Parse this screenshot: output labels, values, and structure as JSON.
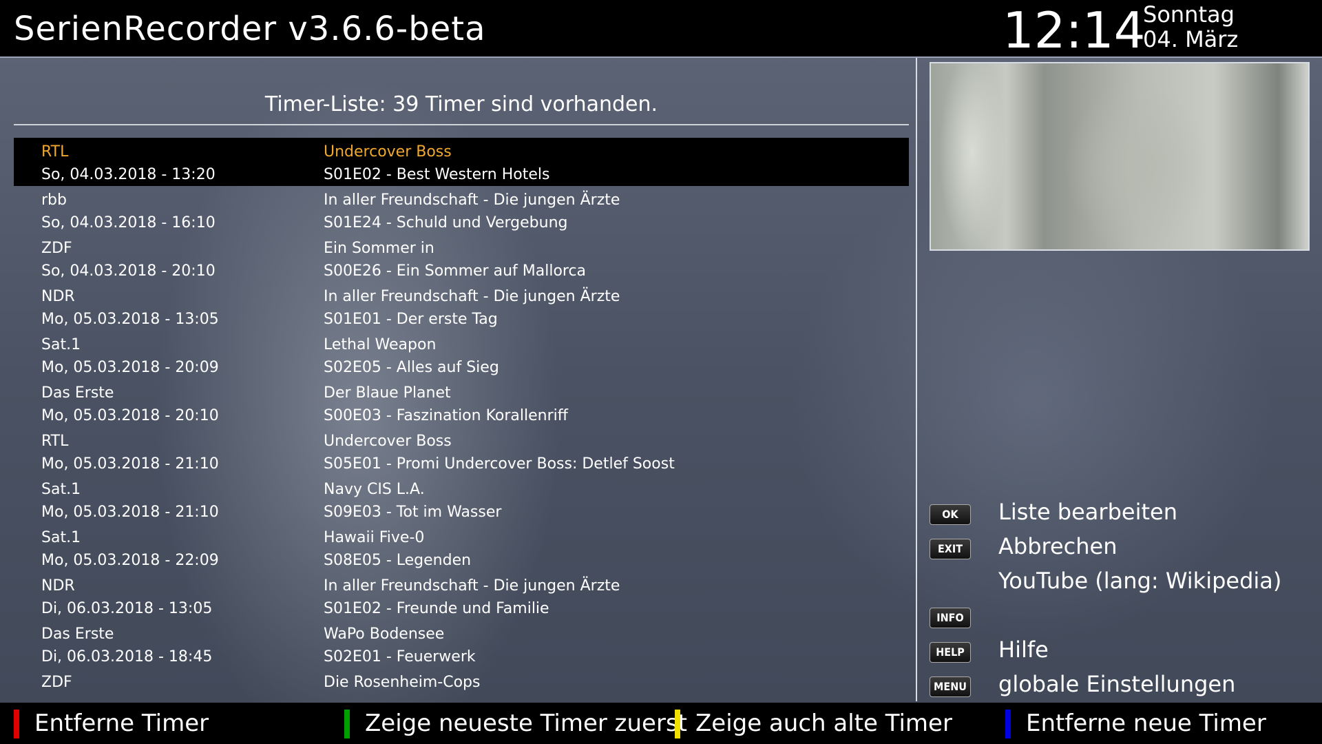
{
  "header": {
    "title": "SerienRecorder v3.6.6-beta",
    "time": "12:14",
    "day": "Sonntag",
    "date": "04. März"
  },
  "list": {
    "heading": "Timer-Liste: 39 Timer sind vorhanden.",
    "rows": [
      {
        "channel": "RTL",
        "datetime": "So, 04.03.2018 - 13:20",
        "series": "Undercover Boss",
        "episode": "S01E02 - Best Western Hotels",
        "selected": true
      },
      {
        "channel": "rbb",
        "datetime": "So, 04.03.2018 - 16:10",
        "series": "In aller Freundschaft - Die jungen Ärzte",
        "episode": "S01E24 - Schuld und Vergebung"
      },
      {
        "channel": "ZDF",
        "datetime": "So, 04.03.2018 - 20:10",
        "series": "Ein Sommer in",
        "episode": "S00E26 - Ein Sommer auf Mallorca"
      },
      {
        "channel": "NDR",
        "datetime": "Mo, 05.03.2018 - 13:05",
        "series": "In aller Freundschaft - Die jungen Ärzte",
        "episode": "S01E01 - Der erste Tag"
      },
      {
        "channel": "Sat.1",
        "datetime": "Mo, 05.03.2018 - 20:09",
        "series": "Lethal Weapon",
        "episode": "S02E05 - Alles auf Sieg"
      },
      {
        "channel": "Das Erste",
        "datetime": "Mo, 05.03.2018 - 20:10",
        "series": "Der Blaue Planet",
        "episode": "S00E03 - Faszination Korallenriff"
      },
      {
        "channel": "RTL",
        "datetime": "Mo, 05.03.2018 - 21:10",
        "series": "Undercover Boss",
        "episode": "S05E01 - Promi Undercover Boss: Detlef Soost"
      },
      {
        "channel": "Sat.1",
        "datetime": "Mo, 05.03.2018 - 21:10",
        "series": "Navy CIS L.A.",
        "episode": "S09E03 - Tot im Wasser"
      },
      {
        "channel": "Sat.1",
        "datetime": "Mo, 05.03.2018 - 22:09",
        "series": "Hawaii Five-0",
        "episode": "S08E05 - Legenden"
      },
      {
        "channel": "NDR",
        "datetime": "Di, 06.03.2018 - 13:05",
        "series": "In aller Freundschaft - Die jungen Ärzte",
        "episode": "S01E02 - Freunde und Familie"
      },
      {
        "channel": "Das Erste",
        "datetime": "Di, 06.03.2018 - 18:45",
        "series": "WaPo Bodensee",
        "episode": "S02E01 - Feuerwerk"
      },
      {
        "channel": "ZDF",
        "datetime": "",
        "series": "Die Rosenheim-Cops",
        "episode": ""
      }
    ]
  },
  "keys": [
    {
      "key": "OK",
      "label": "Liste bearbeiten"
    },
    {
      "key": "EXIT",
      "label": "Abbrechen"
    },
    {
      "key": "",
      "label": "YouTube (lang: Wikipedia)"
    },
    {
      "key": "INFO",
      "label": ""
    },
    {
      "key": "HELP",
      "label": "Hilfe"
    },
    {
      "key": "MENU",
      "label": "globale Einstellungen"
    }
  ],
  "color_buttons": [
    {
      "color": "#e00000",
      "label": "Entferne Timer"
    },
    {
      "color": "#00a000",
      "label": "Zeige neueste Timer zuerst"
    },
    {
      "color": "#f0e000",
      "label": "Zeige auch alte Timer"
    },
    {
      "color": "#0000e0",
      "label": "Entferne neue Timer"
    }
  ]
}
